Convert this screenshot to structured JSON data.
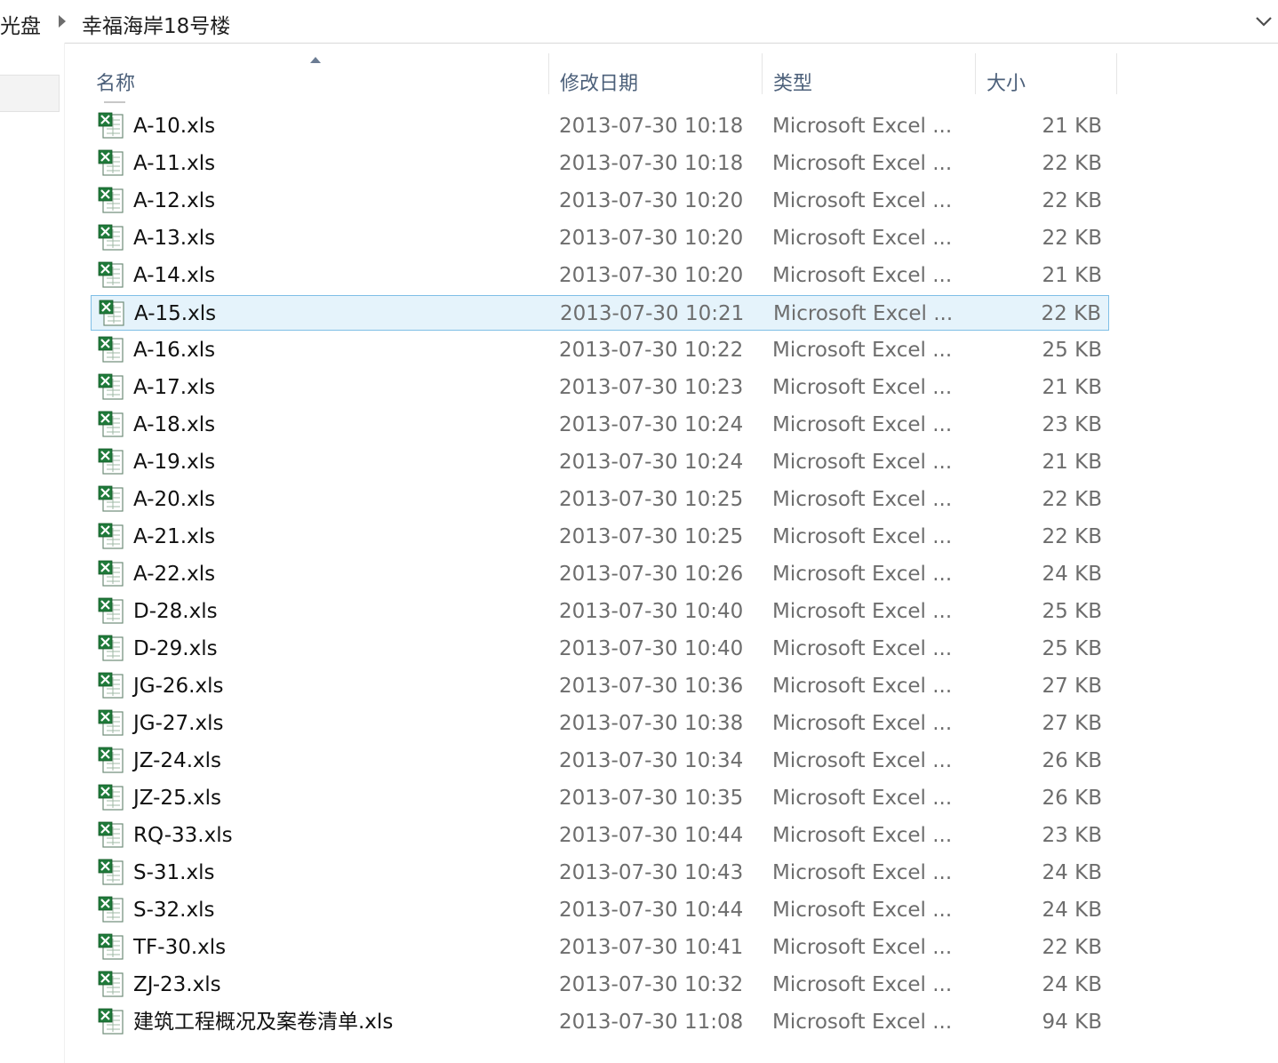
{
  "address_bar": {
    "crumbs": [
      "光盘",
      "幸福海岸18号楼"
    ]
  },
  "columns": {
    "name": "名称",
    "date": "修改日期",
    "type": "类型",
    "size": "大小"
  },
  "files": [
    {
      "name": "A-10.xls",
      "date": "2013-07-30 10:18",
      "type": "Microsoft Excel ...",
      "size": "21 KB"
    },
    {
      "name": "A-11.xls",
      "date": "2013-07-30 10:18",
      "type": "Microsoft Excel ...",
      "size": "22 KB"
    },
    {
      "name": "A-12.xls",
      "date": "2013-07-30 10:20",
      "type": "Microsoft Excel ...",
      "size": "22 KB"
    },
    {
      "name": "A-13.xls",
      "date": "2013-07-30 10:20",
      "type": "Microsoft Excel ...",
      "size": "22 KB"
    },
    {
      "name": "A-14.xls",
      "date": "2013-07-30 10:20",
      "type": "Microsoft Excel ...",
      "size": "21 KB"
    },
    {
      "name": "A-15.xls",
      "date": "2013-07-30 10:21",
      "type": "Microsoft Excel ...",
      "size": "22 KB",
      "selected": true
    },
    {
      "name": "A-16.xls",
      "date": "2013-07-30 10:22",
      "type": "Microsoft Excel ...",
      "size": "25 KB"
    },
    {
      "name": "A-17.xls",
      "date": "2013-07-30 10:23",
      "type": "Microsoft Excel ...",
      "size": "21 KB"
    },
    {
      "name": "A-18.xls",
      "date": "2013-07-30 10:24",
      "type": "Microsoft Excel ...",
      "size": "23 KB"
    },
    {
      "name": "A-19.xls",
      "date": "2013-07-30 10:24",
      "type": "Microsoft Excel ...",
      "size": "21 KB"
    },
    {
      "name": "A-20.xls",
      "date": "2013-07-30 10:25",
      "type": "Microsoft Excel ...",
      "size": "22 KB"
    },
    {
      "name": "A-21.xls",
      "date": "2013-07-30 10:25",
      "type": "Microsoft Excel ...",
      "size": "22 KB"
    },
    {
      "name": "A-22.xls",
      "date": "2013-07-30 10:26",
      "type": "Microsoft Excel ...",
      "size": "24 KB"
    },
    {
      "name": "D-28.xls",
      "date": "2013-07-30 10:40",
      "type": "Microsoft Excel ...",
      "size": "25 KB"
    },
    {
      "name": "D-29.xls",
      "date": "2013-07-30 10:40",
      "type": "Microsoft Excel ...",
      "size": "25 KB"
    },
    {
      "name": "JG-26.xls",
      "date": "2013-07-30 10:36",
      "type": "Microsoft Excel ...",
      "size": "27 KB"
    },
    {
      "name": "JG-27.xls",
      "date": "2013-07-30 10:38",
      "type": "Microsoft Excel ...",
      "size": "27 KB"
    },
    {
      "name": "JZ-24.xls",
      "date": "2013-07-30 10:34",
      "type": "Microsoft Excel ...",
      "size": "26 KB"
    },
    {
      "name": "JZ-25.xls",
      "date": "2013-07-30 10:35",
      "type": "Microsoft Excel ...",
      "size": "26 KB"
    },
    {
      "name": "RQ-33.xls",
      "date": "2013-07-30 10:44",
      "type": "Microsoft Excel ...",
      "size": "23 KB"
    },
    {
      "name": "S-31.xls",
      "date": "2013-07-30 10:43",
      "type": "Microsoft Excel ...",
      "size": "24 KB"
    },
    {
      "name": "S-32.xls",
      "date": "2013-07-30 10:44",
      "type": "Microsoft Excel ...",
      "size": "24 KB"
    },
    {
      "name": "TF-30.xls",
      "date": "2013-07-30 10:41",
      "type": "Microsoft Excel ...",
      "size": "22 KB"
    },
    {
      "name": "ZJ-23.xls",
      "date": "2013-07-30 10:32",
      "type": "Microsoft Excel ...",
      "size": "24 KB"
    },
    {
      "name": "建筑工程概况及案卷清单.xls",
      "date": "2013-07-30 11:08",
      "type": "Microsoft Excel ...",
      "size": "94 KB"
    }
  ],
  "icons": {
    "file": "excel-file-icon",
    "separator": "breadcrumb-chevron-icon",
    "dropdown": "chevron-down-icon",
    "sort": "sort-ascending-icon"
  },
  "colors": {
    "selection_bg": "#e5f3fb",
    "selection_border": "#7fbfe6",
    "header_text": "#4c607a",
    "secondary_text": "#6d6d6d",
    "excel_green": "#1f7a3a"
  }
}
